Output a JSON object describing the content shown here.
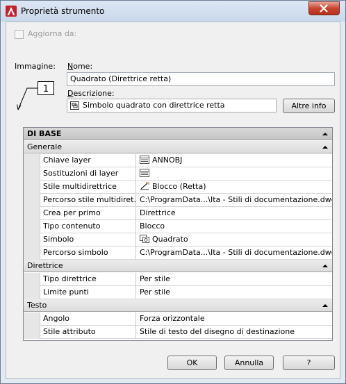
{
  "window": {
    "title": "Proprietà strumento"
  },
  "update_from": {
    "label": "Aggiorna da:",
    "checked": false
  },
  "image": {
    "label": "Immagine:",
    "preview_number": "1"
  },
  "name": {
    "label": "Nome:",
    "value": "Quadrato (Direttrice retta)"
  },
  "description": {
    "label": "Descrizione:",
    "value": "Simbolo quadrato con direttrice retta"
  },
  "buttons": {
    "more_info": "Altre info",
    "ok": "OK",
    "cancel": "Annulla",
    "help": "?"
  },
  "grid": {
    "main_category": "DI BASE",
    "sections": [
      {
        "title": "Generale",
        "rows": [
          {
            "prop": "Chiave layer",
            "value": "ANNOBJ",
            "icon": "layer-list-icon"
          },
          {
            "prop": "Sostituzioni di layer",
            "value": "",
            "icon": "layer-list-icon"
          },
          {
            "prop": "Stile multidirettrice",
            "value": "Blocco (Retta)",
            "icon": "multileader-icon"
          },
          {
            "prop": "Percorso stile multidiret...",
            "value": "C:\\ProgramData...\\Ita - Stili di documentazione.dwg"
          },
          {
            "prop": "Crea per primo",
            "value": "Direttrice"
          },
          {
            "prop": "Tipo contenuto",
            "value": "Blocco"
          },
          {
            "prop": "Simbolo",
            "value": "Quadrato",
            "icon": "block-icon"
          },
          {
            "prop": "Percorso simbolo",
            "value": "C:\\ProgramData...\\Ita - Stili di documentazione.dwg"
          }
        ]
      },
      {
        "title": "Direttrice",
        "rows": [
          {
            "prop": "Tipo direttrice",
            "value": "Per stile"
          },
          {
            "prop": "Limite punti",
            "value": "Per stile"
          }
        ]
      },
      {
        "title": "Testo",
        "rows": [
          {
            "prop": "Angolo",
            "value": "Forza orizzontale"
          },
          {
            "prop": "Stile attributo",
            "value": "Stile di testo del disegno di destinazione"
          }
        ]
      }
    ]
  }
}
